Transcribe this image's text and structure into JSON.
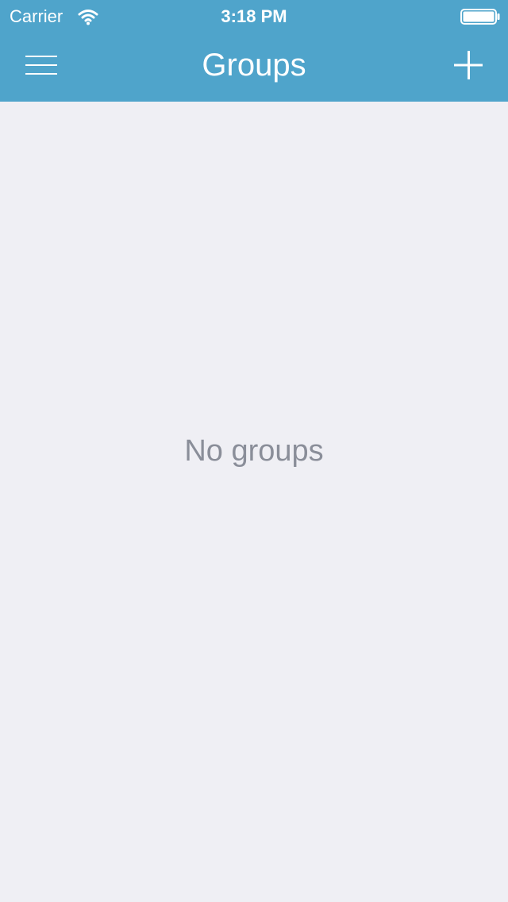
{
  "status_bar": {
    "carrier": "Carrier",
    "time": "3:18 PM",
    "wifi_icon": "wifi-icon",
    "battery_icon": "battery-icon"
  },
  "nav_bar": {
    "title": "Groups",
    "menu_icon": "hamburger-menu-icon",
    "add_icon": "plus-icon"
  },
  "content": {
    "empty_message": "No groups"
  },
  "colors": {
    "header_background": "#4FA4CB",
    "page_background": "#EFEFF4",
    "header_text": "#FFFFFF",
    "empty_text": "#8A8E99"
  }
}
